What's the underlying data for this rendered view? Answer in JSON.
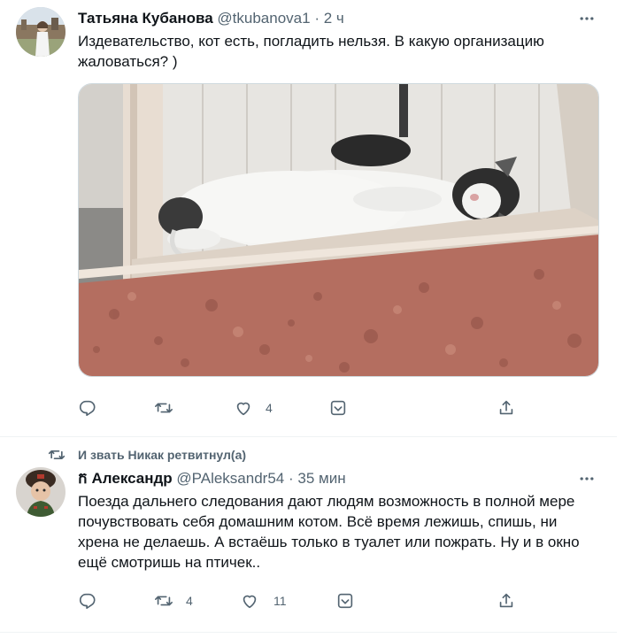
{
  "tweet1": {
    "display_name": "Татьяна Кубанова",
    "handle": "@tkubanova1",
    "separator": "·",
    "time": "2 ч",
    "text": "Издевательство, кот есть, погладить нельзя. В какую организацию жаловаться? )",
    "image_alt": "cat-sleeping-on-window-sill",
    "actions": {
      "reply_count": "",
      "retweet_count": "",
      "like_count": "4"
    }
  },
  "tweet2": {
    "retweeted_by": "И звать Никак ретвитнул(а)",
    "display_name": "ក Александр",
    "handle": "@PAleksandr54",
    "separator": "·",
    "time": "35 мин",
    "text": "Поезда дальнего следования дают людям возможность в полной мере почувствовать себя домашним котом. Всё время лежишь, спишь, ни хрена не делаешь. А встаёшь только в туалет или пожрать. Ну и в окно ещё смотришь на птичек..",
    "actions": {
      "reply_count": "",
      "retweet_count": "4",
      "like_count": "11"
    }
  },
  "colors": {
    "text": "#0f1419",
    "secondary": "#536471",
    "border": "#eff3f4"
  },
  "icons": [
    "more-icon",
    "reply-icon",
    "retweet-icon",
    "like-icon",
    "tip-icon",
    "share-icon"
  ]
}
